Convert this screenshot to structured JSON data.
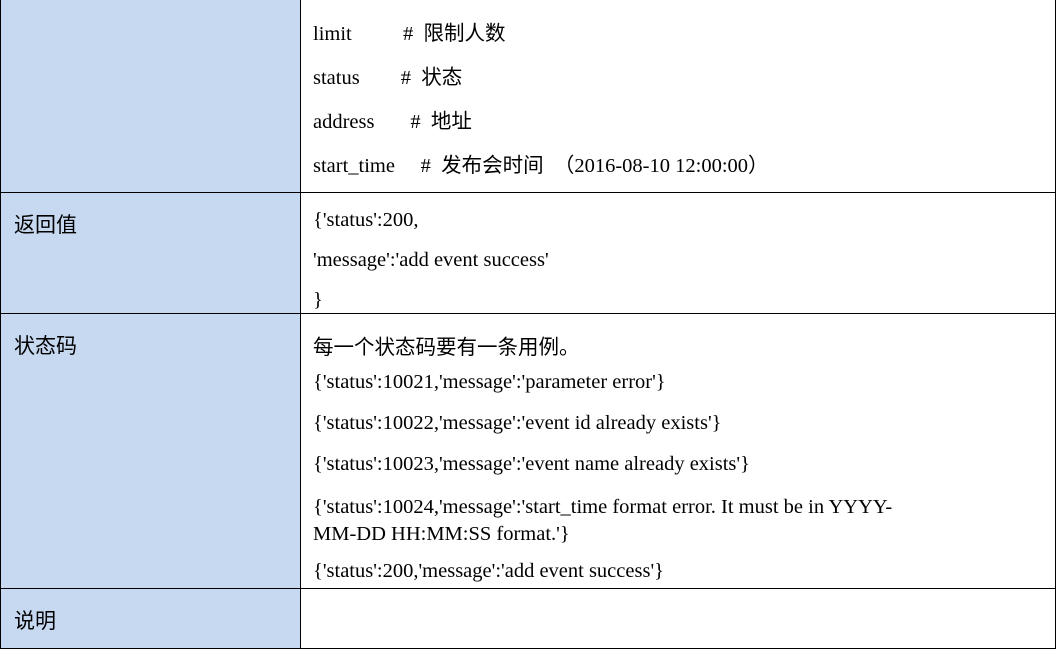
{
  "rows": [
    {
      "label": "",
      "lines": [
        "limit          #  限制人数",
        "status        #  状态",
        "address       #  地址",
        "start_time     #  发布会时间  （2016-08-10 12:00:00）"
      ]
    },
    {
      "label": "返回值",
      "lines": [
        "{'status':200,",
        "'message':'add event success'",
        "}"
      ]
    },
    {
      "label": "状态码",
      "lines": [
        "每一个状态码要有一条用例。",
        "{'status':10021,'message':'parameter error'}",
        "{'status':10022,'message':'event id already exists'}",
        "{'status':10023,'message':'event name already exists'}",
        "{'status':10024,'message':'start_time format error. It must be in YYYY-MM-DD HH:MM:SS format.'}",
        "{'status':200,'message':'add event success'}"
      ]
    },
    {
      "label": "说明",
      "lines": []
    }
  ]
}
